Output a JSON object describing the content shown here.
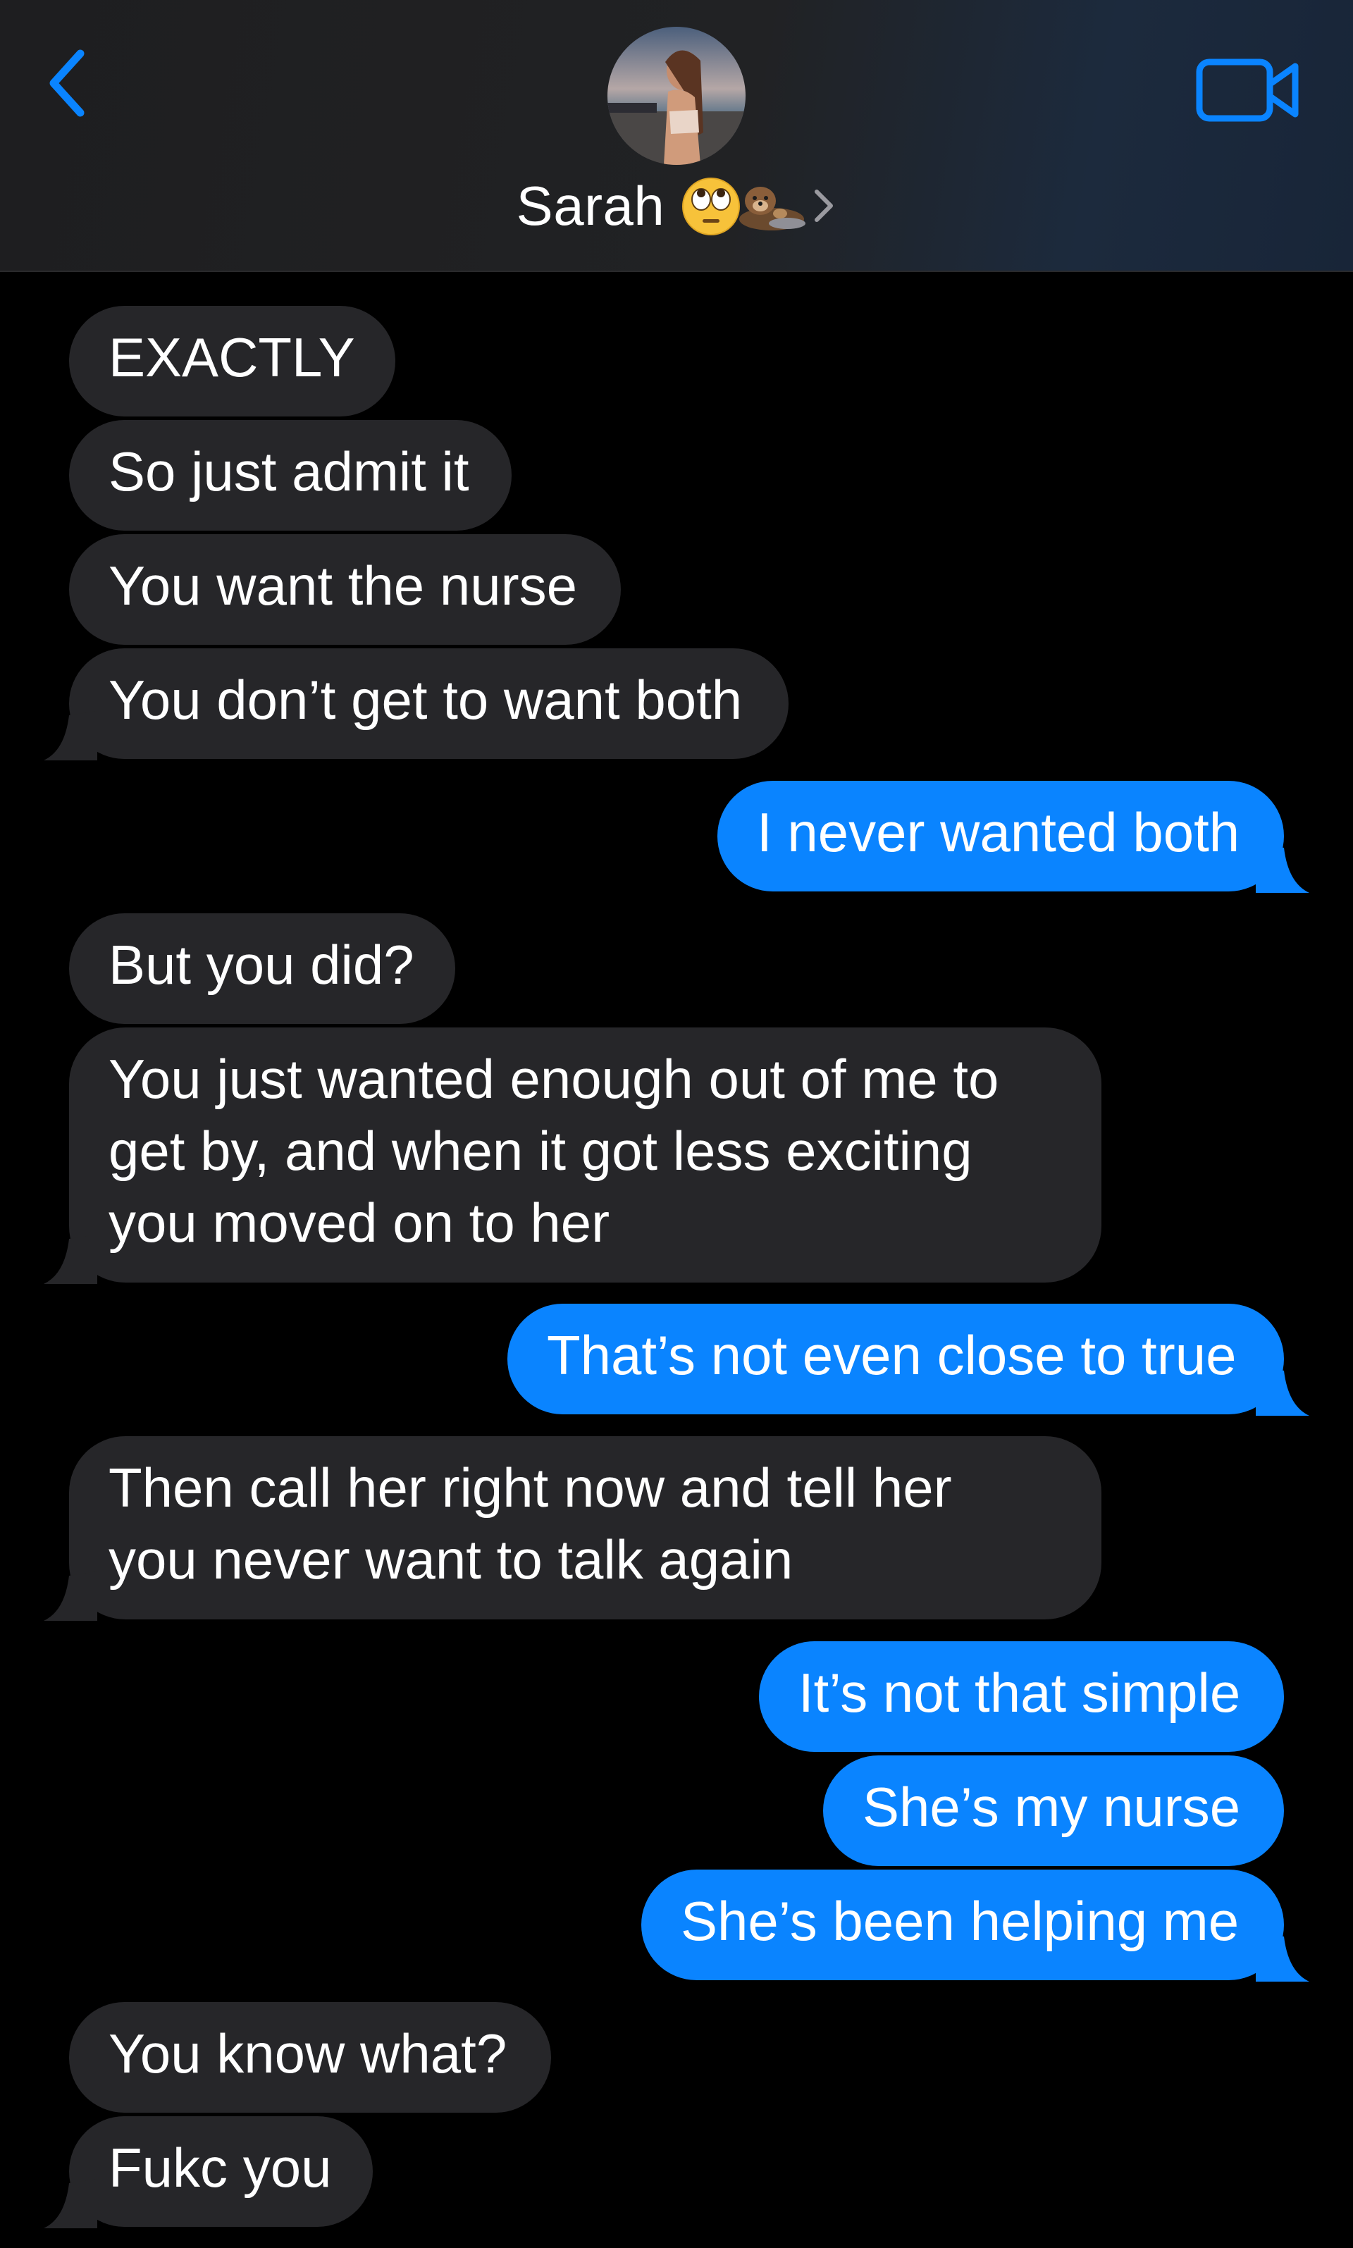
{
  "header": {
    "contact_name": "Sarah",
    "accent_color": "#0a84ff",
    "icons": [
      "back-chevron-icon",
      "video-camera-icon",
      "eye-roll-emoji",
      "otter-emoji",
      "chevron-right-icon"
    ]
  },
  "colors": {
    "incoming_bubble": "#262629",
    "outgoing_bubble": "#0a84ff",
    "background": "#000000",
    "text": "#ffffff"
  },
  "messages": [
    {
      "from": "them",
      "text": "EXACTLY"
    },
    {
      "from": "them",
      "text": "So just admit it"
    },
    {
      "from": "them",
      "text": "You want the nurse"
    },
    {
      "from": "them",
      "text": "You don’t get to want both"
    },
    {
      "from": "me",
      "text": "I never wanted both"
    },
    {
      "from": "them",
      "text": "But you did?"
    },
    {
      "from": "them",
      "lines": [
        "You just wanted enough out of me to",
        "get by, and when it got less exciting",
        "you moved on to her"
      ]
    },
    {
      "from": "me",
      "text": "That’s not even close to true"
    },
    {
      "from": "them",
      "lines": [
        "Then call her right now and tell her",
        "you never want to talk again"
      ]
    },
    {
      "from": "me",
      "text": "It’s not that simple"
    },
    {
      "from": "me",
      "text": "She’s my nurse"
    },
    {
      "from": "me",
      "text": "She’s been helping me"
    },
    {
      "from": "them",
      "text": "You know what?"
    },
    {
      "from": "them",
      "text": "Fukc you"
    }
  ]
}
